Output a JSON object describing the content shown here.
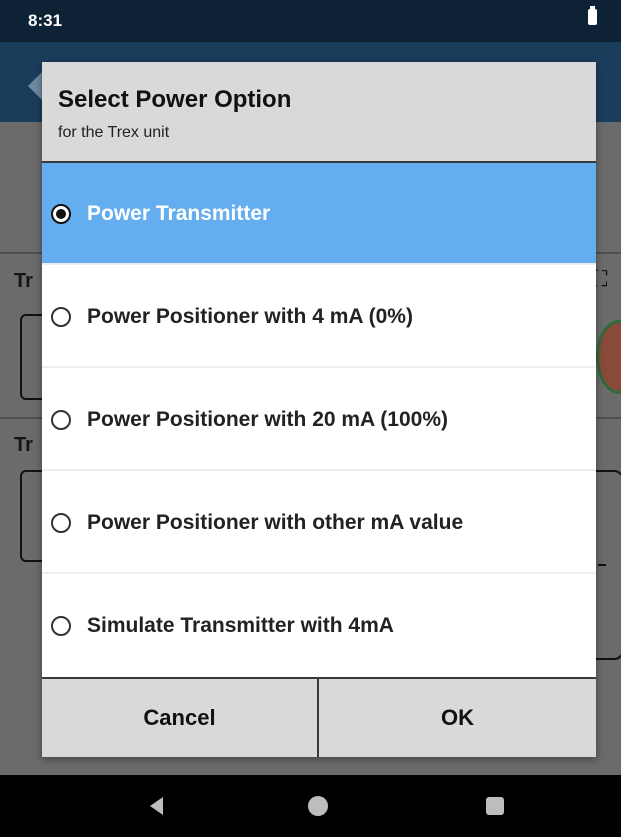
{
  "status_bar": {
    "time": "8:31",
    "battery_icon": "battery-icon"
  },
  "background_app": {
    "section1_label": "Tr",
    "section2_label": "Tr"
  },
  "dialog": {
    "title": "Select Power Option",
    "subtitle": "for the Trex unit",
    "options": [
      {
        "label": "Power Transmitter",
        "selected": true
      },
      {
        "label": "Power Positioner with 4 mA (0%)",
        "selected": false
      },
      {
        "label": "Power Positioner with 20 mA (100%)",
        "selected": false
      },
      {
        "label": "Power Positioner with other mA value",
        "selected": false
      },
      {
        "label": "Simulate Transmitter with 4mA",
        "selected": false
      }
    ],
    "cancel_label": "Cancel",
    "ok_label": "OK"
  },
  "colors": {
    "selected_option": "#64aef0",
    "status_bar": "#0e2235",
    "app_bar": "#1b3d5c"
  },
  "nav_bar": {
    "icons": [
      "back-icon",
      "home-icon",
      "recent-apps-icon"
    ]
  }
}
